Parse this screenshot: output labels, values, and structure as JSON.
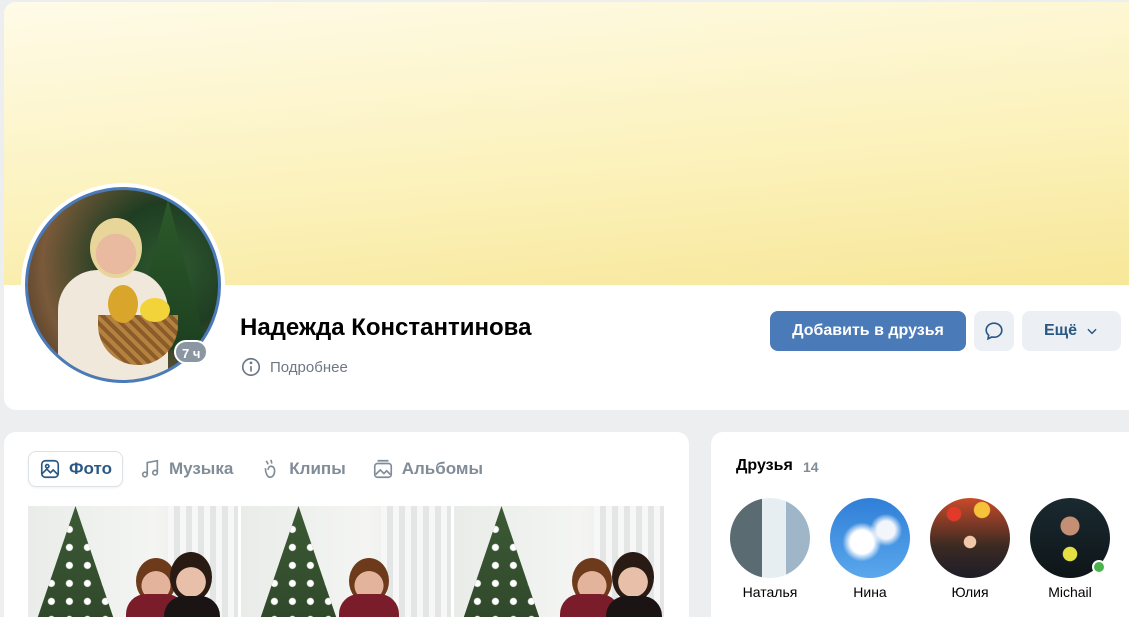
{
  "profile": {
    "name": "Надежда Константинова",
    "last_seen": "7 ч",
    "details_label": "Подробнее"
  },
  "actions": {
    "add_friend": "Добавить в друзья",
    "more": "Ещё"
  },
  "media": {
    "tabs": [
      {
        "label": "Фото",
        "icon": "image-icon",
        "active": true
      },
      {
        "label": "Музыка",
        "icon": "music-note-icon",
        "active": false
      },
      {
        "label": "Клипы",
        "icon": "clips-icon",
        "active": false
      },
      {
        "label": "Альбомы",
        "icon": "albums-icon",
        "active": false
      }
    ]
  },
  "friends": {
    "title": "Друзья",
    "count": "14",
    "items": [
      {
        "name": "Наталья",
        "online": false
      },
      {
        "name": "Нина",
        "online": false
      },
      {
        "name": "Юлия",
        "online": false
      },
      {
        "name": "Michail",
        "online": true
      }
    ]
  },
  "colors": {
    "accent": "#4a7ab8",
    "link": "#2a5885",
    "muted": "#818c99",
    "online": "#4bb34b",
    "background": "#edeef0"
  }
}
